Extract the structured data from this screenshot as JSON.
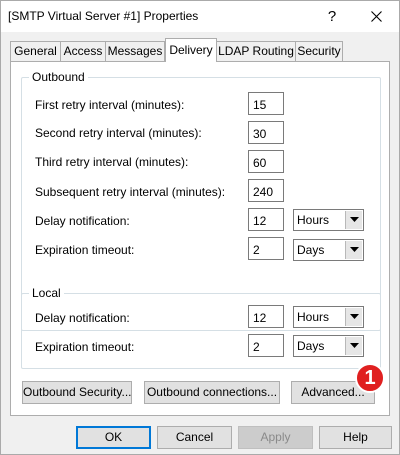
{
  "window": {
    "title": "[SMTP Virtual Server #1] Properties",
    "help_glyph": "?"
  },
  "tabs": [
    {
      "label": "General",
      "active": false
    },
    {
      "label": "Access",
      "active": false
    },
    {
      "label": "Messages",
      "active": false
    },
    {
      "label": "Delivery",
      "active": true
    },
    {
      "label": "LDAP Routing",
      "active": false
    },
    {
      "label": "Security",
      "active": false
    }
  ],
  "outbound": {
    "legend": "Outbound",
    "first_retry": {
      "label": "First retry interval (minutes):",
      "value": "15"
    },
    "second_retry": {
      "label": "Second retry interval (minutes):",
      "value": "30"
    },
    "third_retry": {
      "label": "Third retry interval (minutes):",
      "value": "60"
    },
    "subsequent_retry": {
      "label": "Subsequent retry interval (minutes):",
      "value": "240"
    },
    "delay_notification": {
      "label": "Delay notification:",
      "value": "12",
      "unit": "Hours"
    },
    "expiration_timeout": {
      "label": "Expiration timeout:",
      "value": "2",
      "unit": "Days"
    }
  },
  "local": {
    "legend": "Local",
    "delay_notification": {
      "label": "Delay notification:",
      "value": "12",
      "unit": "Hours"
    },
    "expiration_timeout": {
      "label": "Expiration timeout:",
      "value": "2",
      "unit": "Days"
    }
  },
  "panel_buttons": {
    "outbound_security": "Outbound Security...",
    "outbound_connections": "Outbound connections...",
    "advanced": "Advanced..."
  },
  "dialog_buttons": {
    "ok": "OK",
    "cancel": "Cancel",
    "apply": "Apply",
    "help": "Help"
  },
  "callout": {
    "number": "1",
    "color": "#e02020"
  }
}
